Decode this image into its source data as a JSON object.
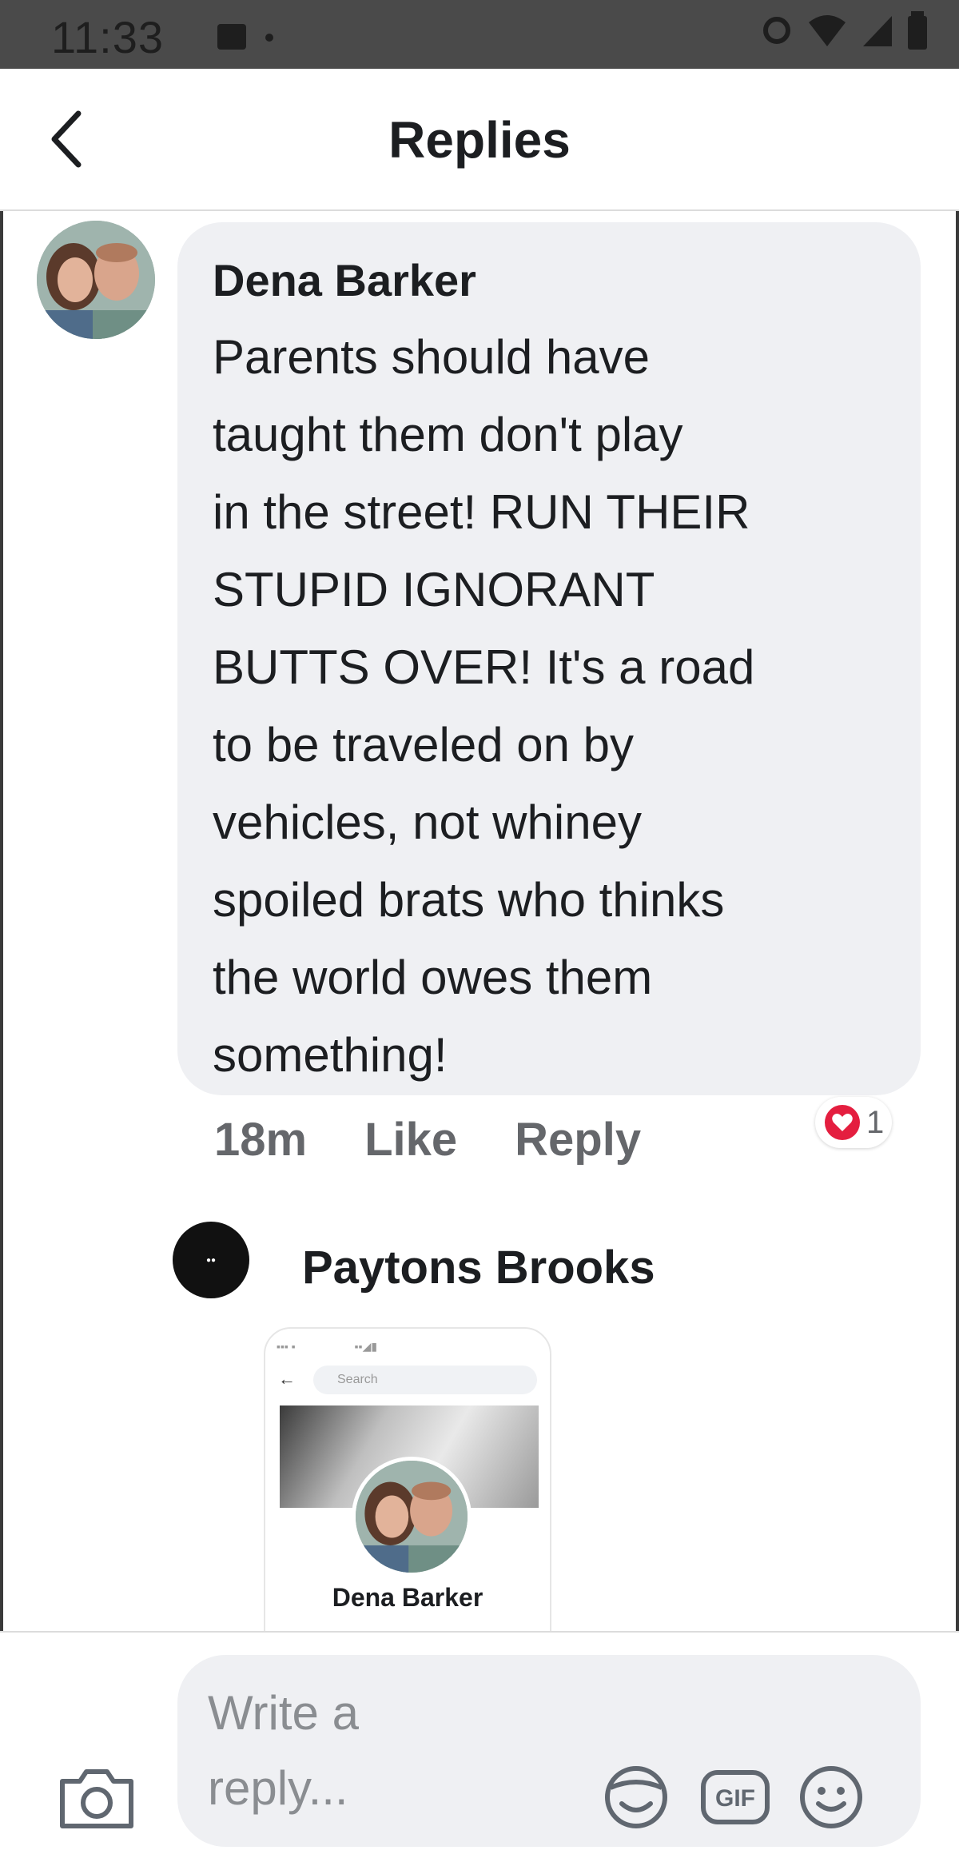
{
  "status_bar": {
    "time": "11:33"
  },
  "header": {
    "title": "Replies"
  },
  "comment": {
    "author": "Dena Barker",
    "text": "Parents should have\ntaught them don't play\nin the street! RUN THEIR\nSTUPID IGNORANT\nBUTTS OVER! It's a road\nto be traveled on by\nvehicles, not whiney\nspoiled brats who thinks\nthe world owes them\nsomething!",
    "time": "18m",
    "like_label": "Like",
    "reply_label": "Reply",
    "reaction_count": "1",
    "reaction_color": "#e41e3f"
  },
  "reply": {
    "author": "Paytons Brooks",
    "attachment": {
      "search_placeholder": "Search",
      "name": "Dena Barker"
    }
  },
  "composer": {
    "placeholder": "Write a\nreply...",
    "icons": [
      "camera-icon",
      "sticker-icon",
      "gif-icon",
      "emoji-icon"
    ]
  }
}
